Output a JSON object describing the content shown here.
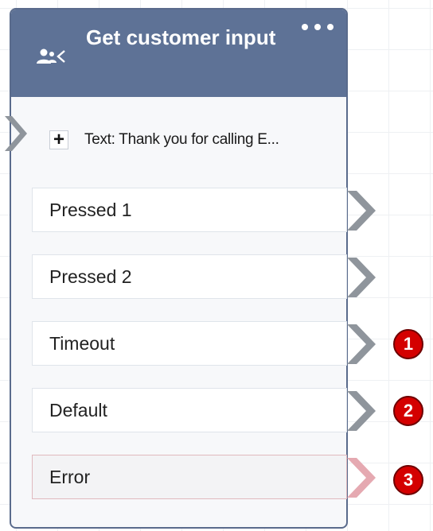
{
  "block": {
    "title": "Get customer input",
    "prompt_text": "Text: Thank you for calling E...",
    "add_symbol": "+",
    "menu_icon": "ellipsis-icon",
    "type_icon": "customer-input-icon"
  },
  "branches": [
    {
      "label": "Pressed 1"
    },
    {
      "label": "Pressed 2"
    },
    {
      "label": "Timeout",
      "callout": "1"
    },
    {
      "label": "Default",
      "callout": "2"
    },
    {
      "label": "Error",
      "callout": "3"
    }
  ],
  "colors": {
    "header": "#5e7296",
    "border": "#5a6b8c",
    "arrow": "#8f959c",
    "error_arrow": "#e5a9b1",
    "callout": "#d40000"
  }
}
